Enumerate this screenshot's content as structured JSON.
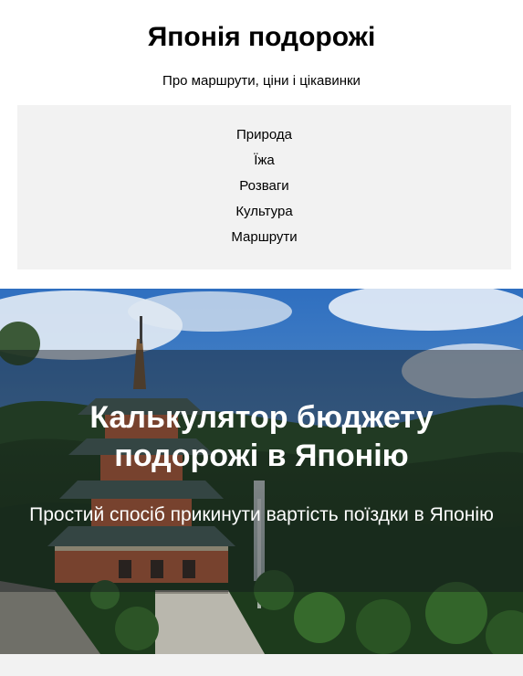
{
  "header": {
    "title": "Японія подорожі",
    "tagline": "Про маршрути, ціни і цікавинки"
  },
  "nav": {
    "items": [
      {
        "label": "Природа"
      },
      {
        "label": "Їжа"
      },
      {
        "label": "Розваги"
      },
      {
        "label": "Культура"
      },
      {
        "label": "Маршрути"
      }
    ]
  },
  "hero": {
    "title": "Калькулятор бюджету подорожі в Японію",
    "subtitle": "Простий спосіб прикинути вартість поїздки в Японію",
    "image_subject": "pagoda-waterfall-forest-photo"
  },
  "colors": {
    "nav_background": "#f2f2f2",
    "hero_text": "#ffffff",
    "pagoda": "#c8643c"
  }
}
